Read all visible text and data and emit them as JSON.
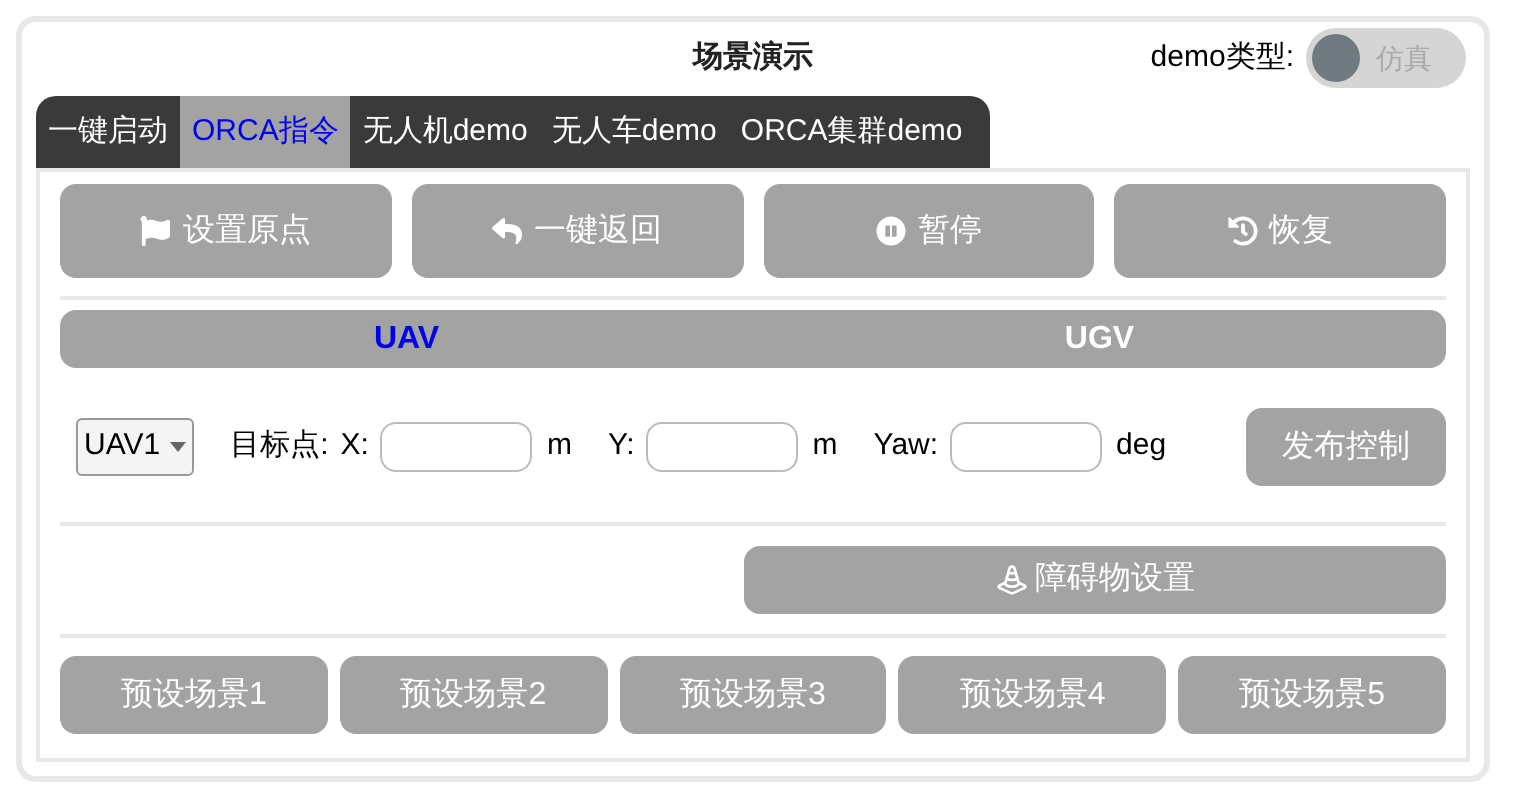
{
  "title": "场景演示",
  "demo_type": {
    "label": "demo类型:",
    "toggle_text": "仿真",
    "on": false
  },
  "tabs": [
    {
      "label": "一键启动",
      "selected": false
    },
    {
      "label": "ORCA指令",
      "selected": true
    },
    {
      "label": "无人机demo",
      "selected": false
    },
    {
      "label": "无人车demo",
      "selected": false
    },
    {
      "label": "ORCA集群demo",
      "selected": false
    }
  ],
  "actions": [
    {
      "label": "设置原点",
      "kind": "origin"
    },
    {
      "label": "一键返回",
      "kind": "return"
    },
    {
      "label": "暂停",
      "kind": "pause"
    },
    {
      "label": "恢复",
      "kind": "resume"
    }
  ],
  "vehicle_tabs": [
    {
      "label": "UAV",
      "selected": true
    },
    {
      "label": "UGV",
      "selected": false
    }
  ],
  "control": {
    "vehicle": "UAV1",
    "target_label": "目标点:",
    "fields": [
      {
        "label": "X:",
        "unit": "m"
      },
      {
        "label": "Y:",
        "unit": "m"
      },
      {
        "label": "Yaw:",
        "unit": "deg"
      }
    ],
    "publish": "发布控制"
  },
  "obstacle_button": "障碍物设置",
  "presets": [
    "预设场景1",
    "预设场景2",
    "预设场景3",
    "预设场景4",
    "预设场景5"
  ]
}
